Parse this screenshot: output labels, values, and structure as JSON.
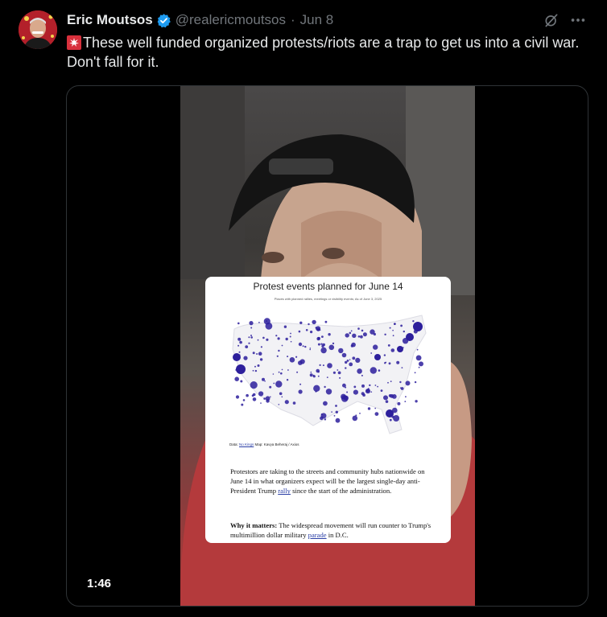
{
  "tweet": {
    "author_name": "Eric Moutsos",
    "handle": "@realericmoutsos",
    "separator": "·",
    "date": "Jun 8",
    "text": "These well funded organized protests/riots are a trap to get us into a civil war. Don't fall for it.",
    "icons": {
      "verified": "verified-badge-icon",
      "grok": "grok-icon",
      "more": "more-options-icon",
      "siren": "siren-emoji-icon"
    },
    "colors": {
      "verified": "#1d9bf0",
      "text": "#e7e9ea",
      "secondary": "#71767b"
    }
  },
  "video": {
    "duration": "1:46",
    "card": {
      "title": "Protest events planned for June 14",
      "subtitle": "Places with planned rallies, meetings or visibility events; As of June 3, 2025",
      "credit_prefix": "Data: ",
      "credit_link": "No Kings",
      "credit_suffix": " Map: Kavya Beheraj / Axios",
      "body_1": "Protestors are taking to the streets and community hubs nationwide on June 14 in what organizers expect will be the largest single-day anti-President Trump ",
      "body_link": "rally",
      "body_2": " since the start of the administration.",
      "why_label": "Why it matters:",
      "why_1": " The widespread movement will run counter to Trump's multimillion dollar military ",
      "why_link": "parade",
      "why_2": " in D.C."
    }
  }
}
